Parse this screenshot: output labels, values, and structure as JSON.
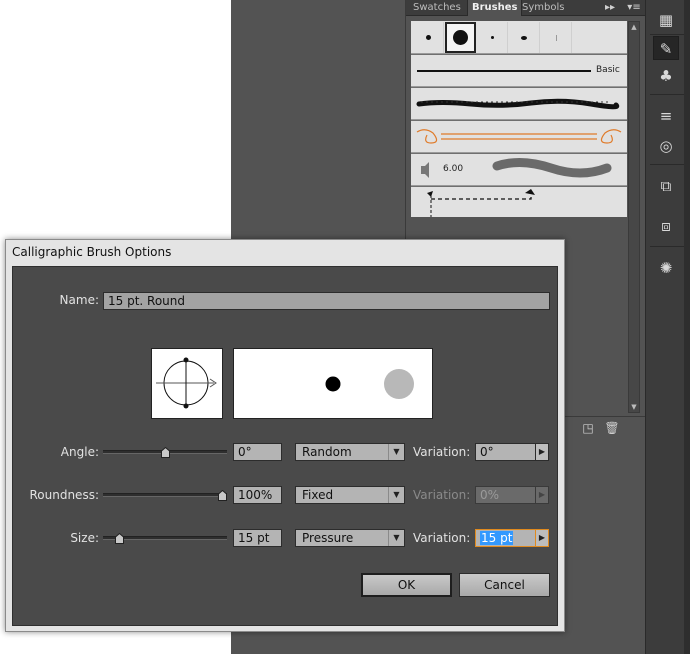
{
  "panel": {
    "tabs": [
      "Swatches",
      "Brushes",
      "Symbols"
    ],
    "active_tab": "Brushes",
    "brushes": {
      "basic_label": "Basic",
      "bristle_size": "6.00"
    }
  },
  "dialog": {
    "title": "Calligraphic Brush Options",
    "name_label": "Name:",
    "name_value": "15 pt. Round",
    "angle": {
      "label": "Angle:",
      "value": "0°",
      "mode": "Random",
      "variation_label": "Variation:",
      "variation_value": "0°",
      "slider_level": 0.5
    },
    "roundness": {
      "label": "Roundness:",
      "value": "100%",
      "mode": "Fixed",
      "variation_label": "Variation:",
      "variation_value": "0%",
      "slider_level": 1.0
    },
    "size": {
      "label": "Size:",
      "value": "15 pt",
      "mode": "Pressure",
      "variation_label": "Variation:",
      "variation_value": "15 pt",
      "slider_level": 0.1
    },
    "ok_label": "OK",
    "cancel_label": "Cancel"
  },
  "colors": {
    "accent_focus": "#e08a1e",
    "selection": "#3399ff",
    "dialog_bg": "#4a4a4a",
    "brush_orange": "#e07b2a"
  }
}
